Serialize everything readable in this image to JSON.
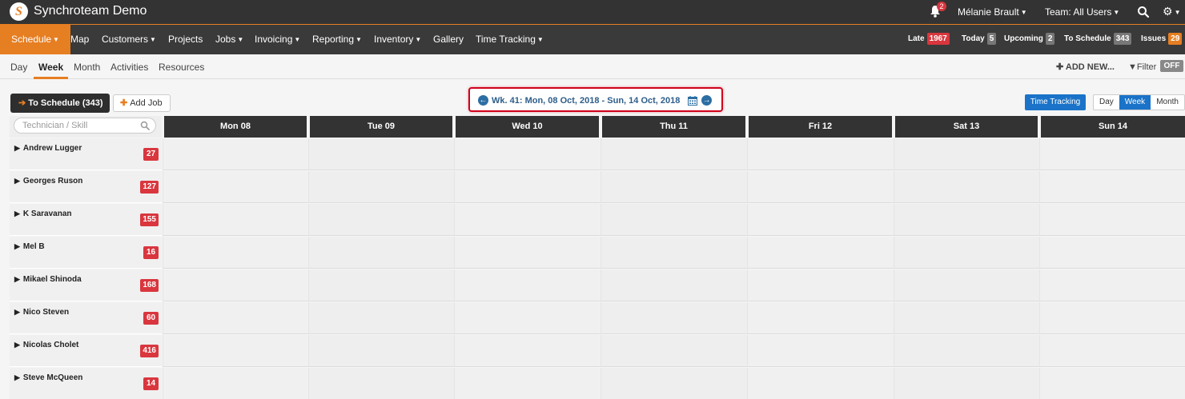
{
  "app": {
    "title": "Synchroteam Demo",
    "logo_letter": "S",
    "notification_count": "2",
    "user_menu": "Mélanie Brault",
    "team_menu": "Team: All Users"
  },
  "nav": {
    "items": [
      {
        "label": "Schedule",
        "dropdown": true
      },
      {
        "label": "Map",
        "dropdown": false
      },
      {
        "label": "Customers",
        "dropdown": true
      },
      {
        "label": "Projects",
        "dropdown": false
      },
      {
        "label": "Jobs",
        "dropdown": true
      },
      {
        "label": "Invoicing",
        "dropdown": true
      },
      {
        "label": "Reporting",
        "dropdown": true
      },
      {
        "label": "Inventory",
        "dropdown": true
      },
      {
        "label": "Gallery",
        "dropdown": false
      },
      {
        "label": "Time Tracking",
        "dropdown": true
      }
    ],
    "stats": [
      {
        "label": "Late",
        "value": "1967",
        "color": "#d9363e"
      },
      {
        "label": "Today",
        "value": "5",
        "color": "#777777"
      },
      {
        "label": "Upcoming",
        "value": "2",
        "color": "#777777"
      },
      {
        "label": "To Schedule",
        "value": "343",
        "color": "#777777"
      },
      {
        "label": "Issues",
        "value": "29",
        "color": "#e67e22"
      }
    ]
  },
  "subnav": {
    "tabs": [
      "Day",
      "Week",
      "Month",
      "Activities",
      "Resources"
    ],
    "active_tab": "Week",
    "add_new": "ADD NEW...",
    "filter_label": "Filter",
    "filter_state": "OFF"
  },
  "toolbar": {
    "to_schedule": "To Schedule (343)",
    "add_job": "Add Job",
    "week_label": "Wk. 41: Mon, 08 Oct, 2018 - Sun, 14 Oct, 2018",
    "time_tracking": "Time Tracking",
    "views": [
      "Day",
      "Week",
      "Month"
    ],
    "active_view": "Week"
  },
  "grid": {
    "search_placeholder": "Technician / Skill",
    "days": [
      "Mon 08",
      "Tue 09",
      "Wed 10",
      "Thu 11",
      "Fri 12",
      "Sat 13",
      "Sun 14"
    ],
    "technicians": [
      {
        "name": "Andrew Lugger",
        "count": "27"
      },
      {
        "name": "Georges Ruson",
        "count": "127"
      },
      {
        "name": "K Saravanan",
        "count": "155"
      },
      {
        "name": "Mel B",
        "count": "16"
      },
      {
        "name": "Mikael Shinoda",
        "count": "168"
      },
      {
        "name": "Nico Steven",
        "count": "60"
      },
      {
        "name": "Nicolas Cholet",
        "count": "416"
      },
      {
        "name": "Steve McQueen",
        "count": "14"
      }
    ]
  },
  "colors": {
    "accent": "#e67e22",
    "primary_blue": "#1a73c8",
    "danger": "#d9363e",
    "dark_bar": "#333333"
  }
}
